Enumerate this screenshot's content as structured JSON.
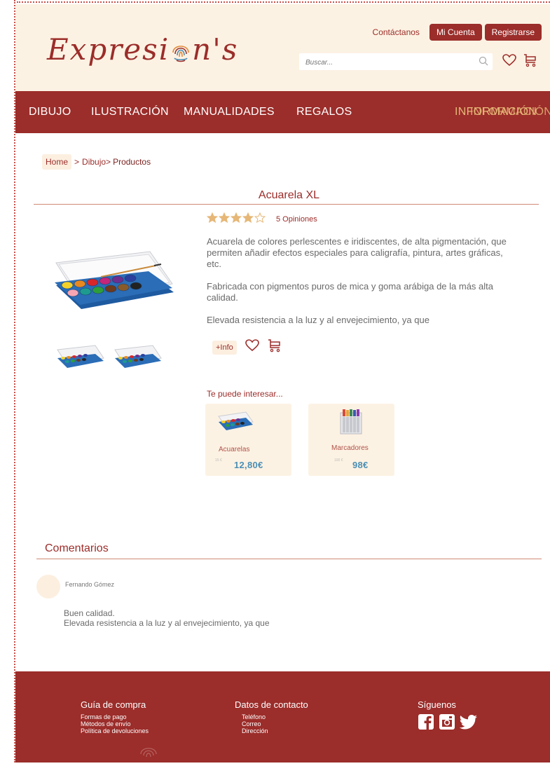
{
  "header": {
    "brand": "Expresi n's",
    "brand_left": "Expresi",
    "brand_right": "n's",
    "contact_label": "Contáctanos",
    "account_label": "Mi Cuenta",
    "register_label": "Registrarse",
    "search_placeholder": "Buscar..."
  },
  "nav": {
    "items": [
      "DIBUJO",
      "ILUSTRACIÓN",
      "MANUALIDADES",
      "REGALOS"
    ],
    "info_label": "INFORMACIÓN",
    "info_label_overlap": "INFORMACIÓN"
  },
  "breadcrumb": {
    "home": "Home",
    "sep1": ">",
    "cat": "Dibujo>",
    "current": "Productos"
  },
  "product": {
    "title": "Acuarela XL",
    "rating": 4,
    "rating_max": 5,
    "reviews": "5 Opiniones",
    "description": [
      "Acuarela de colores perlescentes e iridiscentes, de alta pigmentación, que permiten añadir efectos especiales para caligrafía, pintura, artes gráficas, etc.",
      "Fabricada con pigmentos puros de mica y goma arábiga de la más alta calidad.",
      "Elevada resistencia a la luz y al envejecimiento, ya que"
    ],
    "info_button": "+Info"
  },
  "related": {
    "title": "Te puede interesar...",
    "items": [
      {
        "name": "Acuarelas",
        "old_price": "15 €",
        "price": "12,80€"
      },
      {
        "name": "Marcadores",
        "old_price": "100 €",
        "price": "98€"
      }
    ]
  },
  "comments": {
    "title": "Comentarios",
    "items": [
      {
        "user": "Fernando Gómez",
        "line1": "Buen calidad.",
        "line2": "Elevada resistencia a la luz y al envejecimiento, ya que"
      }
    ]
  },
  "footer": {
    "guide": {
      "title": "Guía de compra",
      "links": [
        "Formas de pago",
        "Métodos de envío",
        "Política de devoluciones"
      ]
    },
    "contact": {
      "title": "Datos de contacto",
      "links": [
        "Teléfono",
        "Correo",
        "Dirección"
      ]
    },
    "social": {
      "title": "Síguenos",
      "icons": [
        "facebook-icon",
        "instagram-icon",
        "twitter-icon"
      ]
    }
  },
  "colors": {
    "brand_red": "#9b2d2a",
    "cream": "#fcf2e3",
    "price_blue": "#4c8fb5",
    "star": "#e6b777"
  }
}
